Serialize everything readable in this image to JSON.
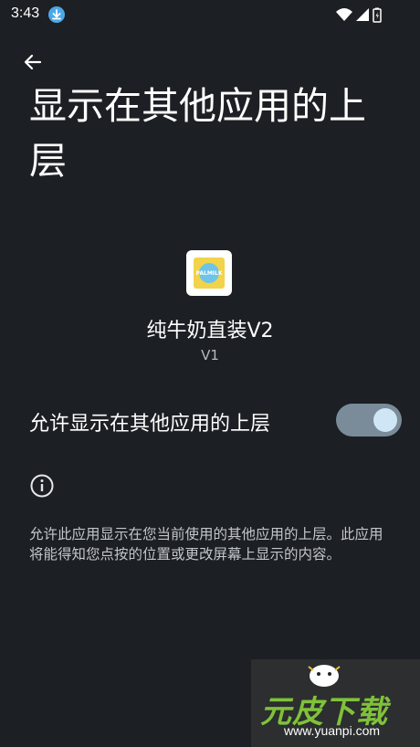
{
  "status_bar": {
    "time": "3:43",
    "icons": [
      "download-icon",
      "wifi-icon",
      "signal-icon",
      "battery-icon"
    ]
  },
  "page": {
    "title": "显示在其他应用的上层"
  },
  "app": {
    "name": "纯牛奶直装V2",
    "version": "V1",
    "icon_text": "PALMILK"
  },
  "permission": {
    "label": "允许显示在其他应用的上层",
    "enabled": true
  },
  "info": {
    "description": "允许此应用显示在您当前使用的其他应用的上层。此应用将能得知您点按的位置或更改屏幕上显示的内容。"
  },
  "watermark": {
    "logo": "元皮下载",
    "url": "www.yuanpi.com"
  },
  "colors": {
    "background": "#1c1f23",
    "toggle_track": "#7a8c99",
    "toggle_thumb": "#cfe6f7",
    "download_badge": "#4aa8e8",
    "watermark_green": "#7fc23a"
  }
}
